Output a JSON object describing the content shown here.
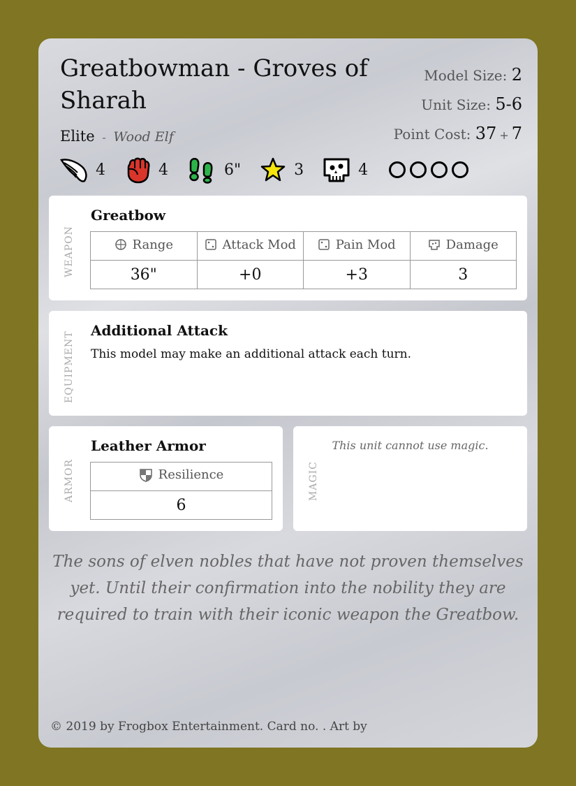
{
  "card": {
    "title": "Greatbowman - Groves of Sharah",
    "rank": "Elite",
    "separator": "-",
    "race": "Wood Elf",
    "model_size_label": "Model Size:",
    "model_size": "2",
    "unit_size_label": "Unit Size:",
    "unit_size": "5-6",
    "point_cost_label": "Point Cost:",
    "point_cost_base": "37",
    "point_cost_plus": "+",
    "point_cost_extra": "7"
  },
  "stats": [
    {
      "icon": "wing-icon",
      "value": "4"
    },
    {
      "icon": "fist-icon",
      "value": "4"
    },
    {
      "icon": "footprints-icon",
      "value": "6\""
    },
    {
      "icon": "star-icon",
      "value": "3"
    },
    {
      "icon": "skull-icon",
      "value": "4"
    }
  ],
  "pips": 4,
  "weapon": {
    "section_label": "Weapon",
    "name": "Greatbow",
    "headers": [
      "Range",
      "Attack Mod",
      "Pain Mod",
      "Damage"
    ],
    "values": [
      "36\"",
      "+0",
      "+3",
      "3"
    ]
  },
  "equipment": {
    "section_label": "Equipment",
    "name": "Additional Attack",
    "text": "This model may make an additional attack each turn."
  },
  "armor": {
    "section_label": "Armor",
    "name": "Leather Armor",
    "header": "Resilience",
    "value": "6"
  },
  "magic": {
    "section_label": "Magic",
    "text": "This unit cannot use magic."
  },
  "flavor": "The sons of elven nobles that have not proven themselves yet. Until their confirmation into the nobility they are required to train with their iconic weapon the Greatbow.",
  "footer": "© 2019 by Frogbox Entertainment. Card no. . Art by",
  "colors": {
    "background": "#7f7522",
    "fist": "#d9352b",
    "footprints": "#2cb34a",
    "star": "#f5e50b"
  }
}
